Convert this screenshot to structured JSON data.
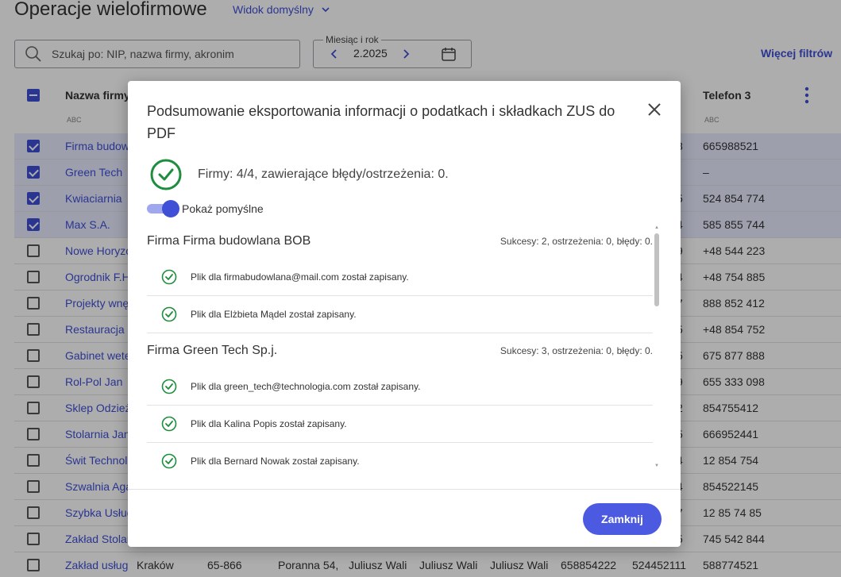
{
  "page": {
    "title": "Operacje wielofirmowe",
    "view_label": "Widok domyślny",
    "search_placeholder": "Szukaj po: NIP, nazwa firmy, akronim",
    "month_label": "Miesiąc i rok",
    "month_value": "2.2025",
    "more_filters": "Więcej filtrów",
    "accent_color": "#3f4fd6"
  },
  "table": {
    "columns": [
      "Nazwa firmy",
      "Telefon 3"
    ],
    "abc_label": "ABC",
    "rows": [
      {
        "name": "Firma budowlana BOB",
        "tel2": "8",
        "tel3": "665988521",
        "selected": true
      },
      {
        "name": "Green Tech",
        "tel2": "",
        "tel3": "–",
        "selected": true
      },
      {
        "name": "Kwiaciarnia",
        "tel2": "5",
        "tel3": "524 854 774",
        "selected": true
      },
      {
        "name": "Max S.A.",
        "tel2": "4",
        "tel3": "585 855 744",
        "selected": true
      },
      {
        "name": "Nowe Horyzonty",
        "tel2": "9",
        "tel3": "+48 544 223",
        "selected": false
      },
      {
        "name": "Ogrodnik F.H.",
        "tel2": "4",
        "tel3": "+48 754 885",
        "selected": false
      },
      {
        "name": "Projekty wnętrz",
        "tel2": "7",
        "tel3": "888 852 412",
        "selected": false
      },
      {
        "name": "Restauracja",
        "tel2": "5",
        "tel3": "+48 854 752",
        "selected": false
      },
      {
        "name": "Gabinet weterynaryjny",
        "tel2": "5",
        "tel3": "675 877 888",
        "selected": false
      },
      {
        "name": "Rol-Pol Jan",
        "tel2": "9",
        "tel3": "655 333 098",
        "selected": false
      },
      {
        "name": "Sklep Odzieżowy",
        "tel2": "2",
        "tel3": "854755412",
        "selected": false
      },
      {
        "name": "Stolarnia Jan",
        "tel2": "5",
        "tel3": "666952441",
        "selected": false
      },
      {
        "name": "Świt Technologie",
        "tel2": "4",
        "tel3": "12 854 754",
        "selected": false
      },
      {
        "name": "Szwalnia Agata",
        "tel2": "4",
        "tel3": "854522145",
        "selected": false
      },
      {
        "name": "Szybka Usługa",
        "tel2": "7",
        "tel3": "12 85 74 85",
        "selected": false
      },
      {
        "name": "Zakład Stolarski",
        "tel2": "5",
        "tel3": "745 542 844",
        "selected": false
      },
      {
        "name": "Zakład usług",
        "city": "Kraków",
        "zip": "65-866",
        "street": "Poranna 54,",
        "p1": "Juliusz Wali",
        "p2": "Juliusz Wali",
        "p3": "Juliusz Wali",
        "t1": "658854222",
        "tel2full": "524452111",
        "tel3": "588774521",
        "selected": false
      }
    ]
  },
  "modal": {
    "title": "Podsumowanie eksportowania informacji o podatkach i składkach ZUS do PDF",
    "summary": "Firmy: 4/4, zawierające błędy/ostrzeżenia: 0.",
    "toggle_label": "Pokaż pomyślne",
    "toggle_on": true,
    "firms": [
      {
        "name": "Firma Firma budowlana BOB",
        "stats": "Sukcesy: 2, ostrzeżenia: 0, błędy: 0.",
        "files": [
          "Plik dla firmabudowlana@mail.com został zapisany.",
          "Plik dla Elżbieta Mądel został zapisany."
        ]
      },
      {
        "name": "Firma Green Tech Sp.j.",
        "stats": "Sukcesy: 3, ostrzeżenia: 0, błędy: 0.",
        "files": [
          "Plik dla green_tech@technologia.com został zapisany.",
          "Plik dla Kalina Popis został zapisany.",
          "Plik dla Bernard Nowak został zapisany."
        ]
      }
    ],
    "close_label": "Zamknij",
    "success_color": "#1e8e3e"
  }
}
